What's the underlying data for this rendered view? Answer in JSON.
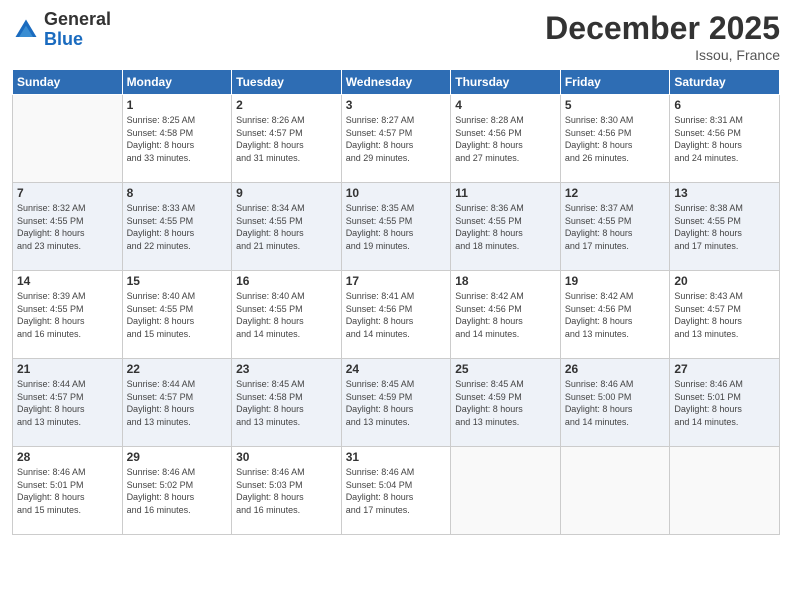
{
  "header": {
    "logo_general": "General",
    "logo_blue": "Blue",
    "title": "December 2025",
    "location": "Issou, France"
  },
  "columns": [
    "Sunday",
    "Monday",
    "Tuesday",
    "Wednesday",
    "Thursday",
    "Friday",
    "Saturday"
  ],
  "weeks": [
    {
      "days": [
        {
          "num": "",
          "info": "",
          "empty": true
        },
        {
          "num": "1",
          "info": "Sunrise: 8:25 AM\nSunset: 4:58 PM\nDaylight: 8 hours\nand 33 minutes."
        },
        {
          "num": "2",
          "info": "Sunrise: 8:26 AM\nSunset: 4:57 PM\nDaylight: 8 hours\nand 31 minutes."
        },
        {
          "num": "3",
          "info": "Sunrise: 8:27 AM\nSunset: 4:57 PM\nDaylight: 8 hours\nand 29 minutes."
        },
        {
          "num": "4",
          "info": "Sunrise: 8:28 AM\nSunset: 4:56 PM\nDaylight: 8 hours\nand 27 minutes."
        },
        {
          "num": "5",
          "info": "Sunrise: 8:30 AM\nSunset: 4:56 PM\nDaylight: 8 hours\nand 26 minutes."
        },
        {
          "num": "6",
          "info": "Sunrise: 8:31 AM\nSunset: 4:56 PM\nDaylight: 8 hours\nand 24 minutes."
        }
      ]
    },
    {
      "days": [
        {
          "num": "7",
          "info": "Sunrise: 8:32 AM\nSunset: 4:55 PM\nDaylight: 8 hours\nand 23 minutes."
        },
        {
          "num": "8",
          "info": "Sunrise: 8:33 AM\nSunset: 4:55 PM\nDaylight: 8 hours\nand 22 minutes."
        },
        {
          "num": "9",
          "info": "Sunrise: 8:34 AM\nSunset: 4:55 PM\nDaylight: 8 hours\nand 21 minutes."
        },
        {
          "num": "10",
          "info": "Sunrise: 8:35 AM\nSunset: 4:55 PM\nDaylight: 8 hours\nand 19 minutes."
        },
        {
          "num": "11",
          "info": "Sunrise: 8:36 AM\nSunset: 4:55 PM\nDaylight: 8 hours\nand 18 minutes."
        },
        {
          "num": "12",
          "info": "Sunrise: 8:37 AM\nSunset: 4:55 PM\nDaylight: 8 hours\nand 17 minutes."
        },
        {
          "num": "13",
          "info": "Sunrise: 8:38 AM\nSunset: 4:55 PM\nDaylight: 8 hours\nand 17 minutes."
        }
      ]
    },
    {
      "days": [
        {
          "num": "14",
          "info": "Sunrise: 8:39 AM\nSunset: 4:55 PM\nDaylight: 8 hours\nand 16 minutes."
        },
        {
          "num": "15",
          "info": "Sunrise: 8:40 AM\nSunset: 4:55 PM\nDaylight: 8 hours\nand 15 minutes."
        },
        {
          "num": "16",
          "info": "Sunrise: 8:40 AM\nSunset: 4:55 PM\nDaylight: 8 hours\nand 14 minutes."
        },
        {
          "num": "17",
          "info": "Sunrise: 8:41 AM\nSunset: 4:56 PM\nDaylight: 8 hours\nand 14 minutes."
        },
        {
          "num": "18",
          "info": "Sunrise: 8:42 AM\nSunset: 4:56 PM\nDaylight: 8 hours\nand 14 minutes."
        },
        {
          "num": "19",
          "info": "Sunrise: 8:42 AM\nSunset: 4:56 PM\nDaylight: 8 hours\nand 13 minutes."
        },
        {
          "num": "20",
          "info": "Sunrise: 8:43 AM\nSunset: 4:57 PM\nDaylight: 8 hours\nand 13 minutes."
        }
      ]
    },
    {
      "days": [
        {
          "num": "21",
          "info": "Sunrise: 8:44 AM\nSunset: 4:57 PM\nDaylight: 8 hours\nand 13 minutes."
        },
        {
          "num": "22",
          "info": "Sunrise: 8:44 AM\nSunset: 4:57 PM\nDaylight: 8 hours\nand 13 minutes."
        },
        {
          "num": "23",
          "info": "Sunrise: 8:45 AM\nSunset: 4:58 PM\nDaylight: 8 hours\nand 13 minutes."
        },
        {
          "num": "24",
          "info": "Sunrise: 8:45 AM\nSunset: 4:59 PM\nDaylight: 8 hours\nand 13 minutes."
        },
        {
          "num": "25",
          "info": "Sunrise: 8:45 AM\nSunset: 4:59 PM\nDaylight: 8 hours\nand 13 minutes."
        },
        {
          "num": "26",
          "info": "Sunrise: 8:46 AM\nSunset: 5:00 PM\nDaylight: 8 hours\nand 14 minutes."
        },
        {
          "num": "27",
          "info": "Sunrise: 8:46 AM\nSunset: 5:01 PM\nDaylight: 8 hours\nand 14 minutes."
        }
      ]
    },
    {
      "days": [
        {
          "num": "28",
          "info": "Sunrise: 8:46 AM\nSunset: 5:01 PM\nDaylight: 8 hours\nand 15 minutes."
        },
        {
          "num": "29",
          "info": "Sunrise: 8:46 AM\nSunset: 5:02 PM\nDaylight: 8 hours\nand 16 minutes."
        },
        {
          "num": "30",
          "info": "Sunrise: 8:46 AM\nSunset: 5:03 PM\nDaylight: 8 hours\nand 16 minutes."
        },
        {
          "num": "31",
          "info": "Sunrise: 8:46 AM\nSunset: 5:04 PM\nDaylight: 8 hours\nand 17 minutes."
        },
        {
          "num": "",
          "info": "",
          "empty": true
        },
        {
          "num": "",
          "info": "",
          "empty": true
        },
        {
          "num": "",
          "info": "",
          "empty": true
        }
      ]
    }
  ]
}
